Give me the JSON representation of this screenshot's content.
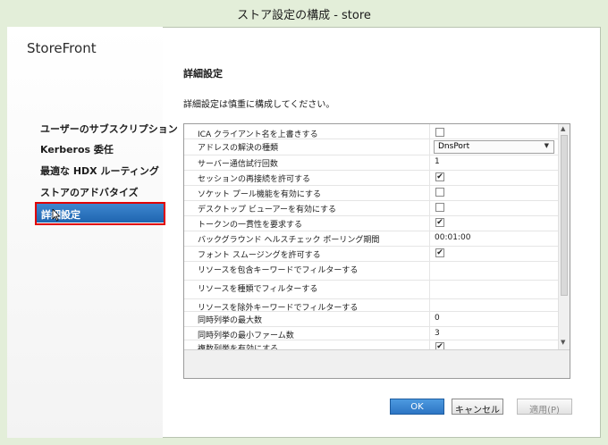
{
  "window": {
    "title": "ストア設定の構成 - store"
  },
  "sidebar": {
    "brand": "StoreFront",
    "items": [
      {
        "label": "ユーザーのサブスクリプション"
      },
      {
        "label": "Kerberos 委任"
      },
      {
        "label": "最適な HDX ルーティング"
      },
      {
        "label": "ストアのアドバタイズ"
      },
      {
        "label": "詳細設定",
        "selected": true
      }
    ]
  },
  "main": {
    "section_title": "詳細設定",
    "description": "詳細設定は慎重に構成してください。",
    "settings": [
      {
        "label": "ICA クライアント名を上書きする",
        "type": "checkbox",
        "checked": false
      },
      {
        "label": "アドレスの解決の種類",
        "type": "dropdown",
        "value": "DnsPort"
      },
      {
        "label": "サーバー通信試行回数",
        "type": "text",
        "value": "1"
      },
      {
        "label": "セッションの再接続を許可する",
        "type": "checkbox",
        "checked": true
      },
      {
        "label": "ソケット プール機能を有効にする",
        "type": "checkbox",
        "checked": false
      },
      {
        "label": "デスクトップ ビューアーを有効にする",
        "type": "checkbox",
        "checked": false
      },
      {
        "label": "トークンの一貫性を要求する",
        "type": "checkbox",
        "checked": true
      },
      {
        "label": "バックグラウンド ヘルスチェック ポーリング期間",
        "type": "text",
        "value": "00:01:00"
      },
      {
        "label": "フォント スムージングを許可する",
        "type": "checkbox",
        "checked": true
      },
      {
        "label": "リソースを包含キーワードでフィルターする",
        "type": "text",
        "value": ""
      },
      {
        "label": "リソースを種類でフィルターする",
        "type": "text",
        "value": ""
      },
      {
        "label": "リソースを除外キーワードでフィルターする",
        "type": "text",
        "value": ""
      },
      {
        "label": "同時列挙の最大数",
        "type": "text",
        "value": "0"
      },
      {
        "label": "同時列挙の最小ファーム数",
        "type": "text",
        "value": "3"
      },
      {
        "label": "複数列挙を有効にする",
        "type": "checkbox",
        "checked": true
      }
    ]
  },
  "buttons": {
    "ok": "OK",
    "cancel": "キャンセル",
    "apply": "適用(P)"
  },
  "colors": {
    "accent": "#2d75c4",
    "selection_outline": "#e00000",
    "frame": "#e3eed9"
  },
  "checkmark": "✔"
}
